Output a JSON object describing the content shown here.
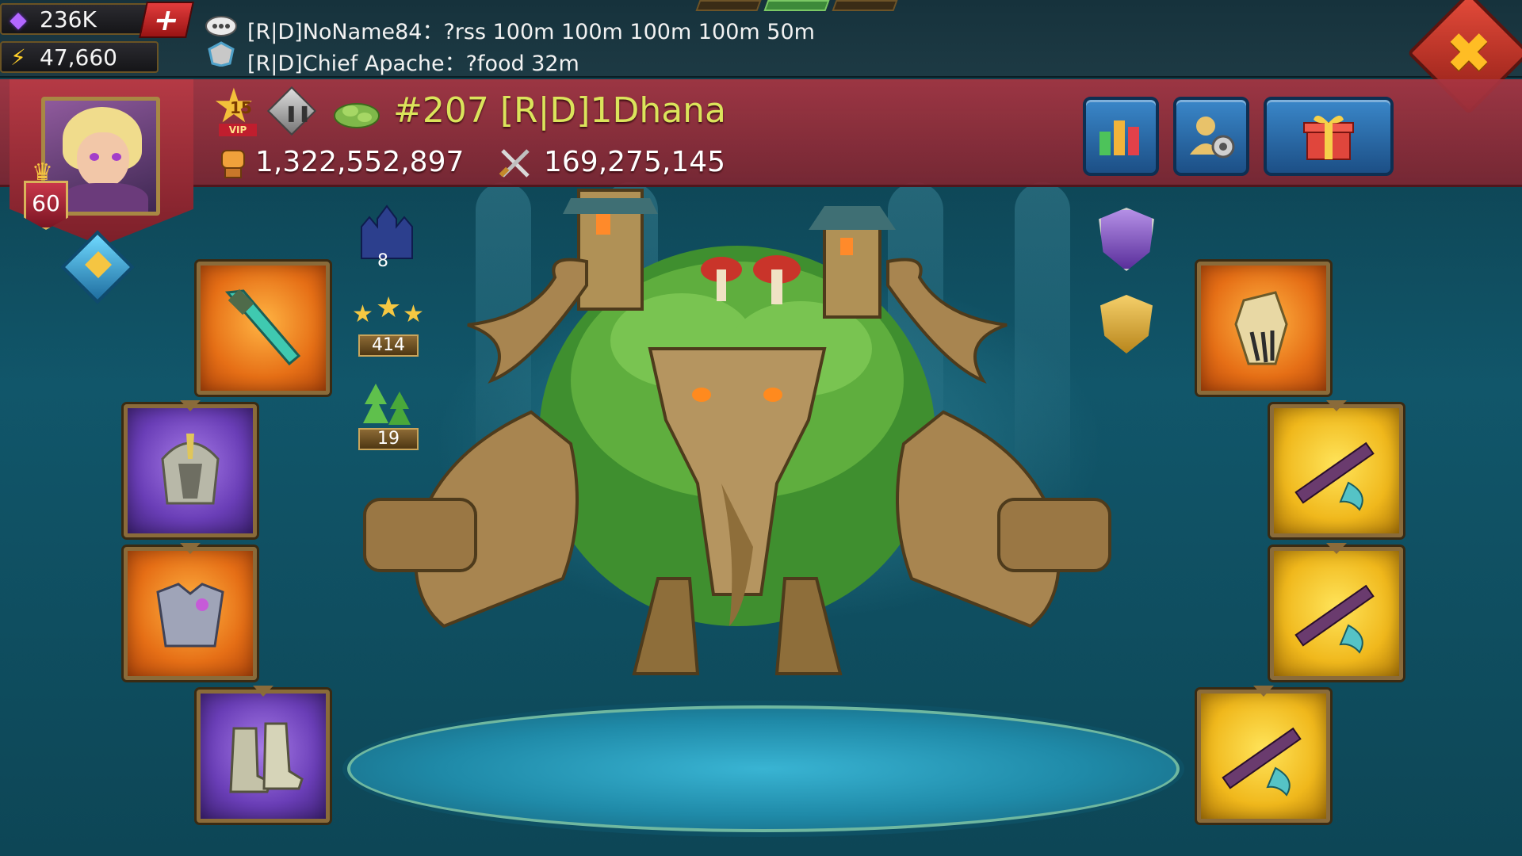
{
  "resources": {
    "gems": "236K",
    "energy": "47,660",
    "add_label": "+"
  },
  "chat": [
    {
      "text": "[R|D]NoName84：?rss 100m 100m 100m 100m 50m"
    },
    {
      "text": "[R|D]Chief Apache：?food 32m"
    }
  ],
  "profile": {
    "level": "60",
    "vip_level": "15",
    "vip_tag": "VIP",
    "name": "#207 [R|D]1Dhana",
    "might": "1,322,552,897",
    "kills": "169,275,145",
    "castle_level": "8",
    "stars": "414",
    "trees": "19"
  },
  "icons": {
    "gem": "gem-icon",
    "energy": "lightning-icon",
    "close": "close-icon",
    "stats": "stats-chart-icon",
    "settings": "account-settings-icon",
    "gift": "gift-icon"
  },
  "close_label": "✖",
  "colors": {
    "banner": "#a83542",
    "name": "#dbe45b",
    "button_blue": "#2a6fae",
    "background": "#11566a"
  }
}
